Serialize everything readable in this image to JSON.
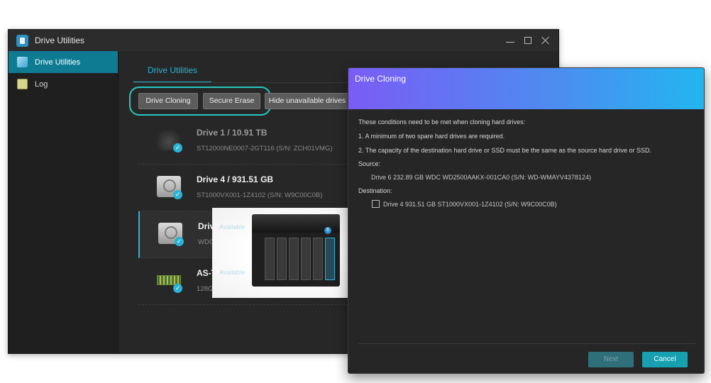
{
  "window": {
    "title": "Drive Utilities"
  },
  "sidebar": {
    "items": [
      {
        "label": "Drive Utilities",
        "icon": "drive-utilities-icon",
        "active": true
      },
      {
        "label": "Log",
        "icon": "log-icon",
        "active": false
      }
    ]
  },
  "tabs": [
    {
      "label": "Drive Utilities"
    }
  ],
  "toolbar": {
    "clone_label": "Drive Cloning",
    "erase_label": "Secure Erase",
    "hide_label": "Hide unavailable drives"
  },
  "drives": [
    {
      "name": "Drive 1 / 10.91 TB",
      "detail": "ST12000NE0007-2GT116 (S/N: ZCH01VMG)",
      "icon": "seagate-icon",
      "available": false
    },
    {
      "name": "Drive 4 / 931.51 GB",
      "detail": "ST1000VX001-1Z4102 (S/N: W9C00C0B)",
      "icon": "hdd-icon",
      "available": true
    },
    {
      "name": "Drive",
      "detail": "WDC",
      "icon": "hdd-icon",
      "available": true
    },
    {
      "name": "AS-T",
      "detail": "128G",
      "icon": "ssd-icon",
      "available": true
    }
  ],
  "nas_overlay": {
    "available_1": "Available",
    "available_2": "Available",
    "badge": "6"
  },
  "dialog": {
    "title": "Drive Cloning",
    "intro": "These conditions need to be met when cloning hard drives:",
    "cond1": "1. A minimum of two spare hard drives are required.",
    "cond2": "2. The capacity of the destination hard drive or SSD must be the same as the source hard drive or SSD.",
    "source_label": "Source:",
    "source_value": "Drive 6 232.89 GB WDC WD2500AAKX-001CA0 (S/N: WD-WMAYV4378124)",
    "dest_label": "Destination:",
    "dest_option": "Drive 4 931.51 GB ST1000VX001-1Z4102 (S/N: W9C00C0B)",
    "next_label": "Next",
    "cancel_label": "Cancel"
  },
  "colors": {
    "accent": "#2ab3d4",
    "highlight_ring": "#28c7c0",
    "active_sidebar": "#0f7b92",
    "cancel": "#17a0b0"
  }
}
